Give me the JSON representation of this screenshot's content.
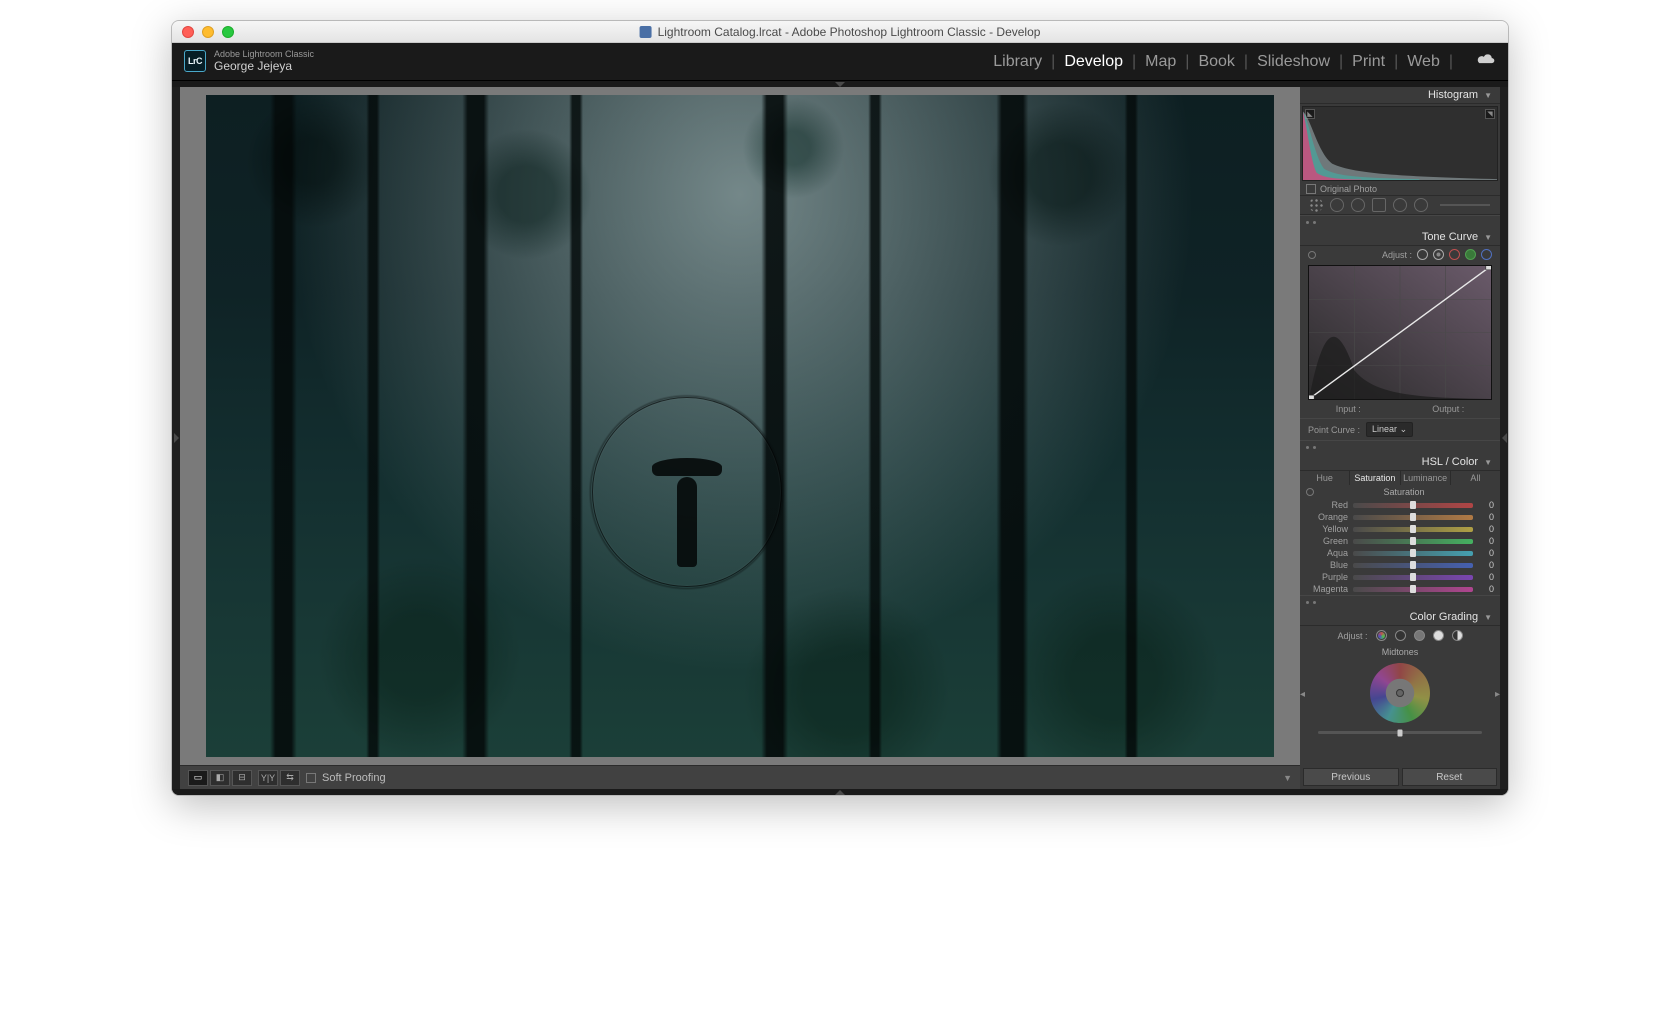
{
  "window": {
    "title": "Lightroom Catalog.lrcat - Adobe Photoshop Lightroom Classic - Develop"
  },
  "header": {
    "app_name": "Adobe Lightroom Classic",
    "user": "George Jejeya",
    "modules": [
      "Library",
      "Develop",
      "Map",
      "Book",
      "Slideshow",
      "Print",
      "Web"
    ],
    "active_module": "Develop"
  },
  "toolbar": {
    "soft_proofing": "Soft Proofing"
  },
  "histogram": {
    "title": "Histogram",
    "original_photo": "Original Photo"
  },
  "tone_curve": {
    "title": "Tone Curve",
    "adjust": "Adjust :",
    "input": "Input :",
    "output": "Output :",
    "point_curve": "Point Curve :",
    "point_curve_value": "Linear"
  },
  "hsl": {
    "title": "HSL / Color",
    "tabs": [
      "Hue",
      "Saturation",
      "Luminance",
      "All"
    ],
    "active_tab": "Saturation",
    "sliders": [
      {
        "label": "Red",
        "value": 0,
        "cls": "sl-red"
      },
      {
        "label": "Orange",
        "value": 0,
        "cls": "sl-orange"
      },
      {
        "label": "Yellow",
        "value": 0,
        "cls": "sl-yellow"
      },
      {
        "label": "Green",
        "value": 0,
        "cls": "sl-green"
      },
      {
        "label": "Aqua",
        "value": 0,
        "cls": "sl-aqua"
      },
      {
        "label": "Blue",
        "value": 0,
        "cls": "sl-blue"
      },
      {
        "label": "Purple",
        "value": 0,
        "cls": "sl-purple"
      },
      {
        "label": "Magenta",
        "value": 0,
        "cls": "sl-magenta"
      }
    ]
  },
  "color_grading": {
    "title": "Color Grading",
    "adjust": "Adjust :",
    "midtones": "Midtones"
  },
  "buttons": {
    "previous": "Previous",
    "reset": "Reset"
  }
}
